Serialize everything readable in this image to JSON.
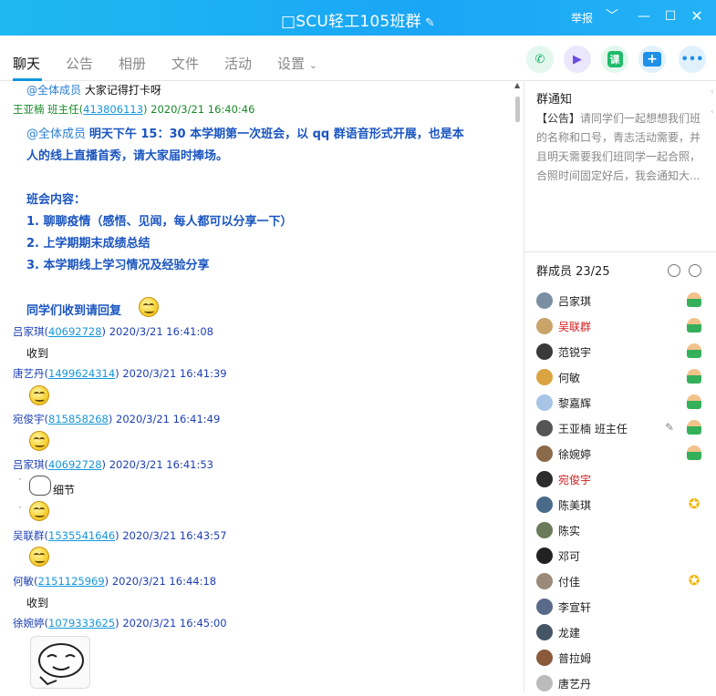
{
  "window": {
    "title": "□SCU轻工105班群",
    "report": "举报"
  },
  "tabs": [
    "聊天",
    "公告",
    "相册",
    "文件",
    "活动",
    "设置"
  ],
  "chat": {
    "m1_mention": "@全体成员",
    "m1_text": "大家记得打卡呀",
    "h_teacher_name": "王亚楠 班主任(",
    "h_teacher_qq": "413806113",
    "h_teacher_time": ") 2020/3/21 16:40:46",
    "n_mention": "@全体成员",
    "n_line1": "明天下午 15：30 本学期第一次班会，以 qq 群语音形式开展，也是本",
    "n_line2": "人的线上直播首秀，请大家届时捧场。",
    "n_line3": "班会内容：",
    "n_line4": "1. 聊聊疫情（感悟、见闻，每人都可以分享一下）",
    "n_line5": "2. 上学期期末成绩总结",
    "n_line6": "3. 本学期线上学习情况及经验分享",
    "n_line7": "同学们收到请回复",
    "h1_name": "吕家琪(",
    "h1_qq": "40692728",
    "h1_time": ") 2020/3/21 16:41:08",
    "t1": "收到",
    "h2_name": "唐艺丹(",
    "h2_qq": "1499624314",
    "h2_time": ") 2020/3/21 16:41:39",
    "h3_name": "宛俊宇(",
    "h3_qq": "815858268",
    "h3_time": ") 2020/3/21 16:41:49",
    "h4_name": "吕家琪(",
    "h4_qq": "40692728",
    "h4_time": ") 2020/3/21 16:41:53",
    "t4": "细节",
    "h5_name": "吴联群(",
    "h5_qq": "1535541646",
    "h5_time": ") 2020/3/21 16:43:57",
    "h6_name": "何敏(",
    "h6_qq": "2151125969",
    "h6_time": ") 2020/3/21 16:44:18",
    "t6": "收到",
    "h7_name": "徐婉婷(",
    "h7_qq": "1079333625",
    "h7_time": ") 2020/3/21 16:45:00"
  },
  "sidebar": {
    "notice_title": "群通知",
    "notice_tag": "【公告】",
    "notice_text": "请同学们一起想想我们班的名称和口号，青志活动需要，并且明天需要我们班同学一起合照，合照时间固定好后，我会通知大...",
    "members_title": "群成员 23/25",
    "members": [
      {
        "name": "吕家琪",
        "red": false,
        "badge": "person"
      },
      {
        "name": "吴联群",
        "red": true,
        "badge": "personstar"
      },
      {
        "name": "范锐宇",
        "red": false,
        "badge": "person"
      },
      {
        "name": "何敏",
        "red": false,
        "badge": "personstar"
      },
      {
        "name": "黎嘉辉",
        "red": false,
        "badge": "person"
      },
      {
        "name": "王亚楠 班主任",
        "red": false,
        "badge": "person",
        "edit": true
      },
      {
        "name": "徐婉婷",
        "red": false,
        "badge": "personstar"
      },
      {
        "name": "宛俊宇",
        "red": true,
        "badge": ""
      },
      {
        "name": "陈美琪",
        "red": false,
        "badge": "star"
      },
      {
        "name": "陈实",
        "red": false,
        "badge": ""
      },
      {
        "name": "邓可",
        "red": false,
        "badge": ""
      },
      {
        "name": "付佳",
        "red": false,
        "badge": "star"
      },
      {
        "name": "李宣轩",
        "red": false,
        "badge": ""
      },
      {
        "name": "龙建",
        "red": false,
        "badge": ""
      },
      {
        "name": "普拉姆",
        "red": false,
        "badge": ""
      },
      {
        "name": "唐艺丹",
        "red": false,
        "badge": ""
      }
    ]
  },
  "colors": {
    "titlebar": "#1fb0f3",
    "accent": "#1296db",
    "mention": "#2a7fd4",
    "notice_blue": "#1a55c0"
  }
}
